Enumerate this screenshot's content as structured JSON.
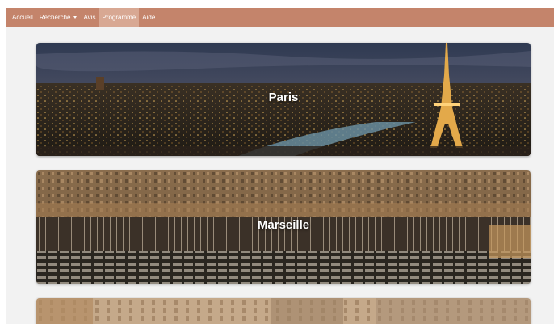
{
  "nav": {
    "items": [
      {
        "label": "Accueil"
      },
      {
        "label": "Recherche"
      },
      {
        "label": "Avis"
      },
      {
        "label": "Programme"
      },
      {
        "label": "Aide"
      }
    ],
    "active": "Programme"
  },
  "cards": [
    {
      "title": "Paris"
    },
    {
      "title": "Marseille"
    }
  ],
  "colors": {
    "navbar": "#c4846b",
    "navbar_active": "#d8a893",
    "page_background": "#f2f2f2"
  }
}
